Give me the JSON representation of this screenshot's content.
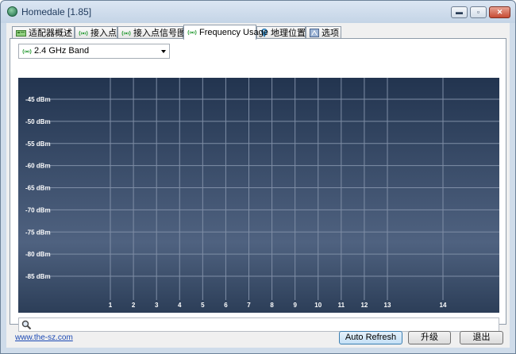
{
  "window": {
    "title": "Homedale [1.85]",
    "controls": {
      "minimize": "▬",
      "restore": "▫",
      "close": "✕"
    }
  },
  "tabs": [
    {
      "label": "适配器概述",
      "icon": "adapter-icon"
    },
    {
      "label": "接入点",
      "icon": "wifi-icon"
    },
    {
      "label": "接入点信号图",
      "icon": "wifi-icon"
    },
    {
      "label": "Frequency Usage",
      "icon": "wifi-icon",
      "active": true
    },
    {
      "label": "地理位置",
      "icon": "location-pin-icon"
    },
    {
      "label": "选项",
      "icon": "options-icon"
    }
  ],
  "band_select": {
    "value": "2.4 GHz Band",
    "icon": "wifi-icon"
  },
  "search": {
    "value": "",
    "icon": "search-icon"
  },
  "footer": {
    "link": "www.the-sz.com",
    "auto_refresh": "Auto Refresh",
    "upgrade": "升级",
    "exit": "退出"
  },
  "colors": {
    "chart_top": "#22344f",
    "chart_mid": "#4f6280",
    "grid": "#7f8ea6",
    "label": "#ffffff",
    "accent_green": "#2f9e3b"
  },
  "chart_data": {
    "type": "line",
    "ylabel": "",
    "xlabel": "",
    "y_ticks": [
      "-45 dBm",
      "-50 dBm",
      "-55 dBm",
      "-60 dBm",
      "-65 dBm",
      "-70 dBm",
      "-75 dBm",
      "-80 dBm",
      "-85 dBm"
    ],
    "y_values": [
      -45,
      -50,
      -55,
      -60,
      -65,
      -70,
      -75,
      -80,
      -85
    ],
    "x_ticks": [
      "1",
      "2",
      "3",
      "4",
      "5",
      "6",
      "7",
      "8",
      "9",
      "10",
      "11",
      "12",
      "13",
      "14"
    ],
    "x_values": [
      1,
      2,
      3,
      4,
      5,
      6,
      7,
      8,
      9,
      10,
      11,
      12,
      13,
      14
    ],
    "series": [],
    "grid": true
  }
}
